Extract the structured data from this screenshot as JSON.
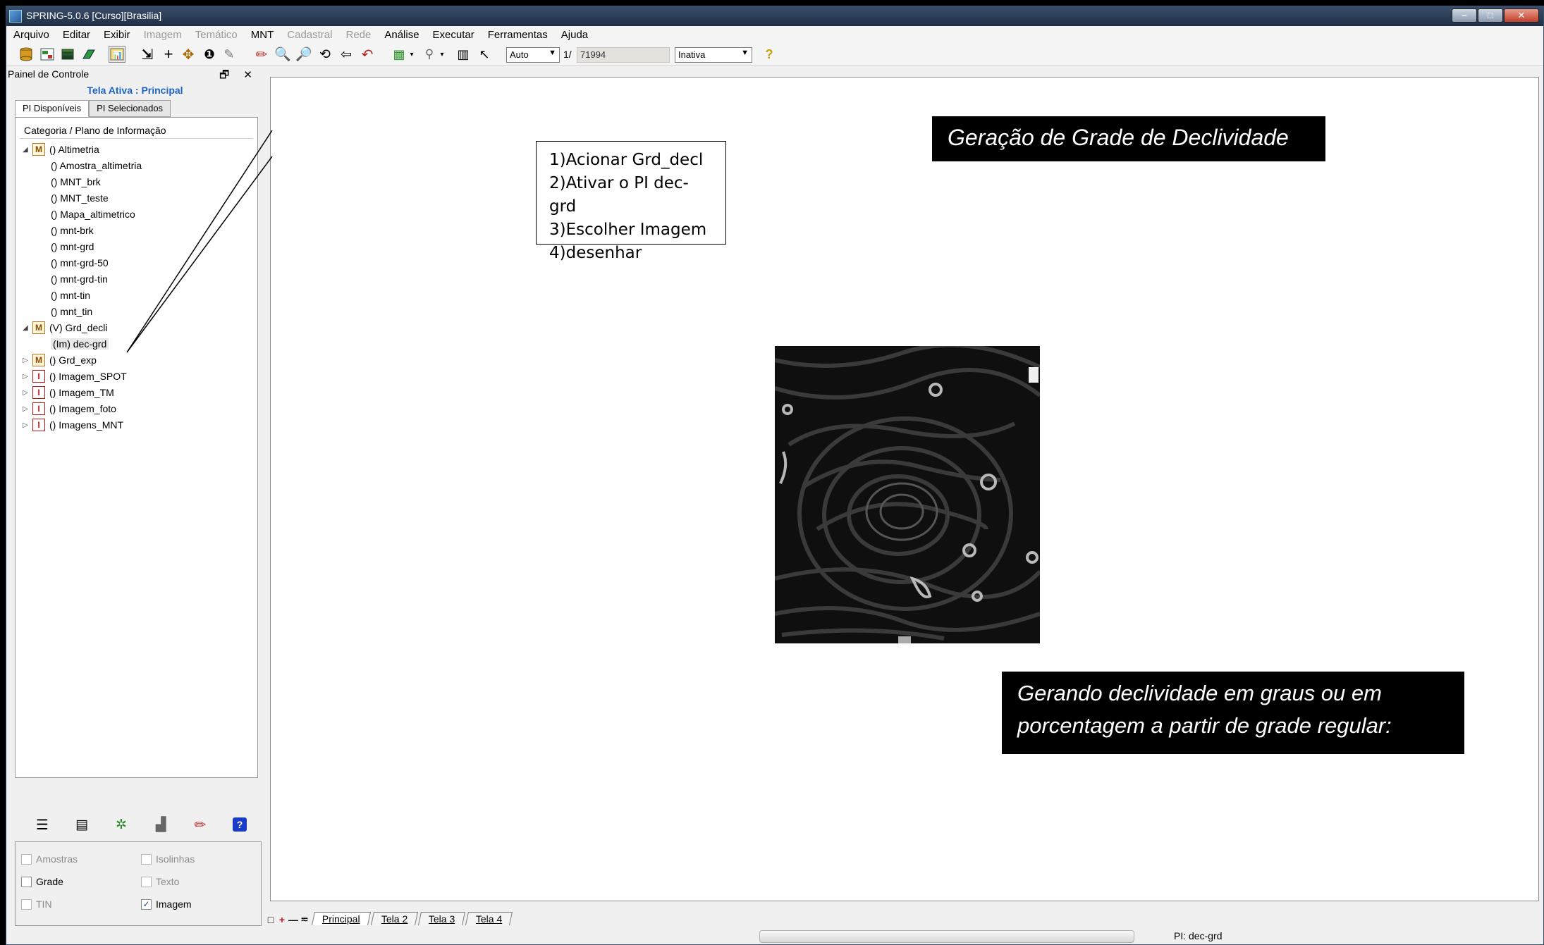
{
  "window": {
    "title": "SPRING-5.0.6 [Curso][Brasilia]",
    "controls": [
      "–",
      "□",
      "✕"
    ]
  },
  "menu": [
    {
      "label": "Arquivo",
      "enabled": true
    },
    {
      "label": "Editar",
      "enabled": true
    },
    {
      "label": "Exibir",
      "enabled": true
    },
    {
      "label": "Imagem",
      "enabled": false
    },
    {
      "label": "Temático",
      "enabled": false
    },
    {
      "label": "MNT",
      "enabled": true
    },
    {
      "label": "Cadastral",
      "enabled": false
    },
    {
      "label": "Rede",
      "enabled": false
    },
    {
      "label": "Análise",
      "enabled": true
    },
    {
      "label": "Executar",
      "enabled": true
    },
    {
      "label": "Ferramentas",
      "enabled": true
    },
    {
      "label": "Ajuda",
      "enabled": true
    }
  ],
  "toolbar": {
    "scale_mode": "Auto",
    "scale_prefix": "1/",
    "scale_value": "71994",
    "cursor_mode": "Inativa",
    "help_glyph": "?"
  },
  "panel": {
    "header": "Painel de Controle",
    "header_buttons": "🗗 ✕",
    "active_screen": "Tela Ativa : Principal",
    "tabs": [
      "PI Disponíveis",
      "PI Selecionados"
    ],
    "tree_header": "Categoria / Plano de Informação",
    "tree": {
      "altimetria": {
        "label": "() Altimetria",
        "badge": "M",
        "expanded": true
      },
      "altimetria_children": [
        "() Amostra_altimetria",
        "() MNT_brk",
        "() MNT_teste",
        "() Mapa_altimetrico",
        "() mnt-brk",
        "() mnt-grd",
        "() mnt-grd-50",
        "() mnt-grd-tin",
        "() mnt-tin",
        "() mnt_tin"
      ],
      "grd_decli": {
        "label": "(V) Grd_decli",
        "badge": "M",
        "expanded": true
      },
      "grd_decli_child": "(Im) dec-grd",
      "collapsed": [
        {
          "label": "() Grd_exp",
          "badge": "M"
        },
        {
          "label": "() Imagem_SPOT",
          "badge": "I"
        },
        {
          "label": "() Imagem_TM",
          "badge": "I"
        },
        {
          "label": "() Imagem_foto",
          "badge": "I"
        },
        {
          "label": "() Imagens_MNT",
          "badge": "I"
        }
      ]
    },
    "checkboxes": {
      "amostras": {
        "label": "Amostras",
        "checked": false,
        "enabled": false
      },
      "isolinhas": {
        "label": "Isolinhas",
        "checked": false,
        "enabled": false
      },
      "grade": {
        "label": "Grade",
        "checked": false,
        "enabled": true
      },
      "texto": {
        "label": "Texto",
        "checked": false,
        "enabled": false
      },
      "tin": {
        "label": "TIN",
        "checked": false,
        "enabled": false
      },
      "imagem": {
        "label": "Imagem",
        "checked": true,
        "enabled": true
      }
    }
  },
  "canvas": {
    "title_banner": "Geração de Grade de Declividade",
    "instructions": [
      "1)Acionar Grd_decl",
      "2)Ativar o PI dec-grd",
      "3)Escolher Imagem",
      "4)desenhar"
    ],
    "subtitle_lines": [
      "Gerando declividade em graus ou em",
      "porcentagem a partir de grade regular:"
    ]
  },
  "screen_tabs": [
    "Principal",
    "Tela 2",
    "Tela 3",
    "Tela 4"
  ],
  "screen_tab_controls": [
    "□",
    "+",
    "—",
    "≂"
  ],
  "status": {
    "pi": "PI: dec-grd"
  },
  "colors": {
    "active_screen": "#1d63c6",
    "titlebar": "#2a3d58",
    "banner_bg": "#000000",
    "banner_text": "#ffffff"
  }
}
